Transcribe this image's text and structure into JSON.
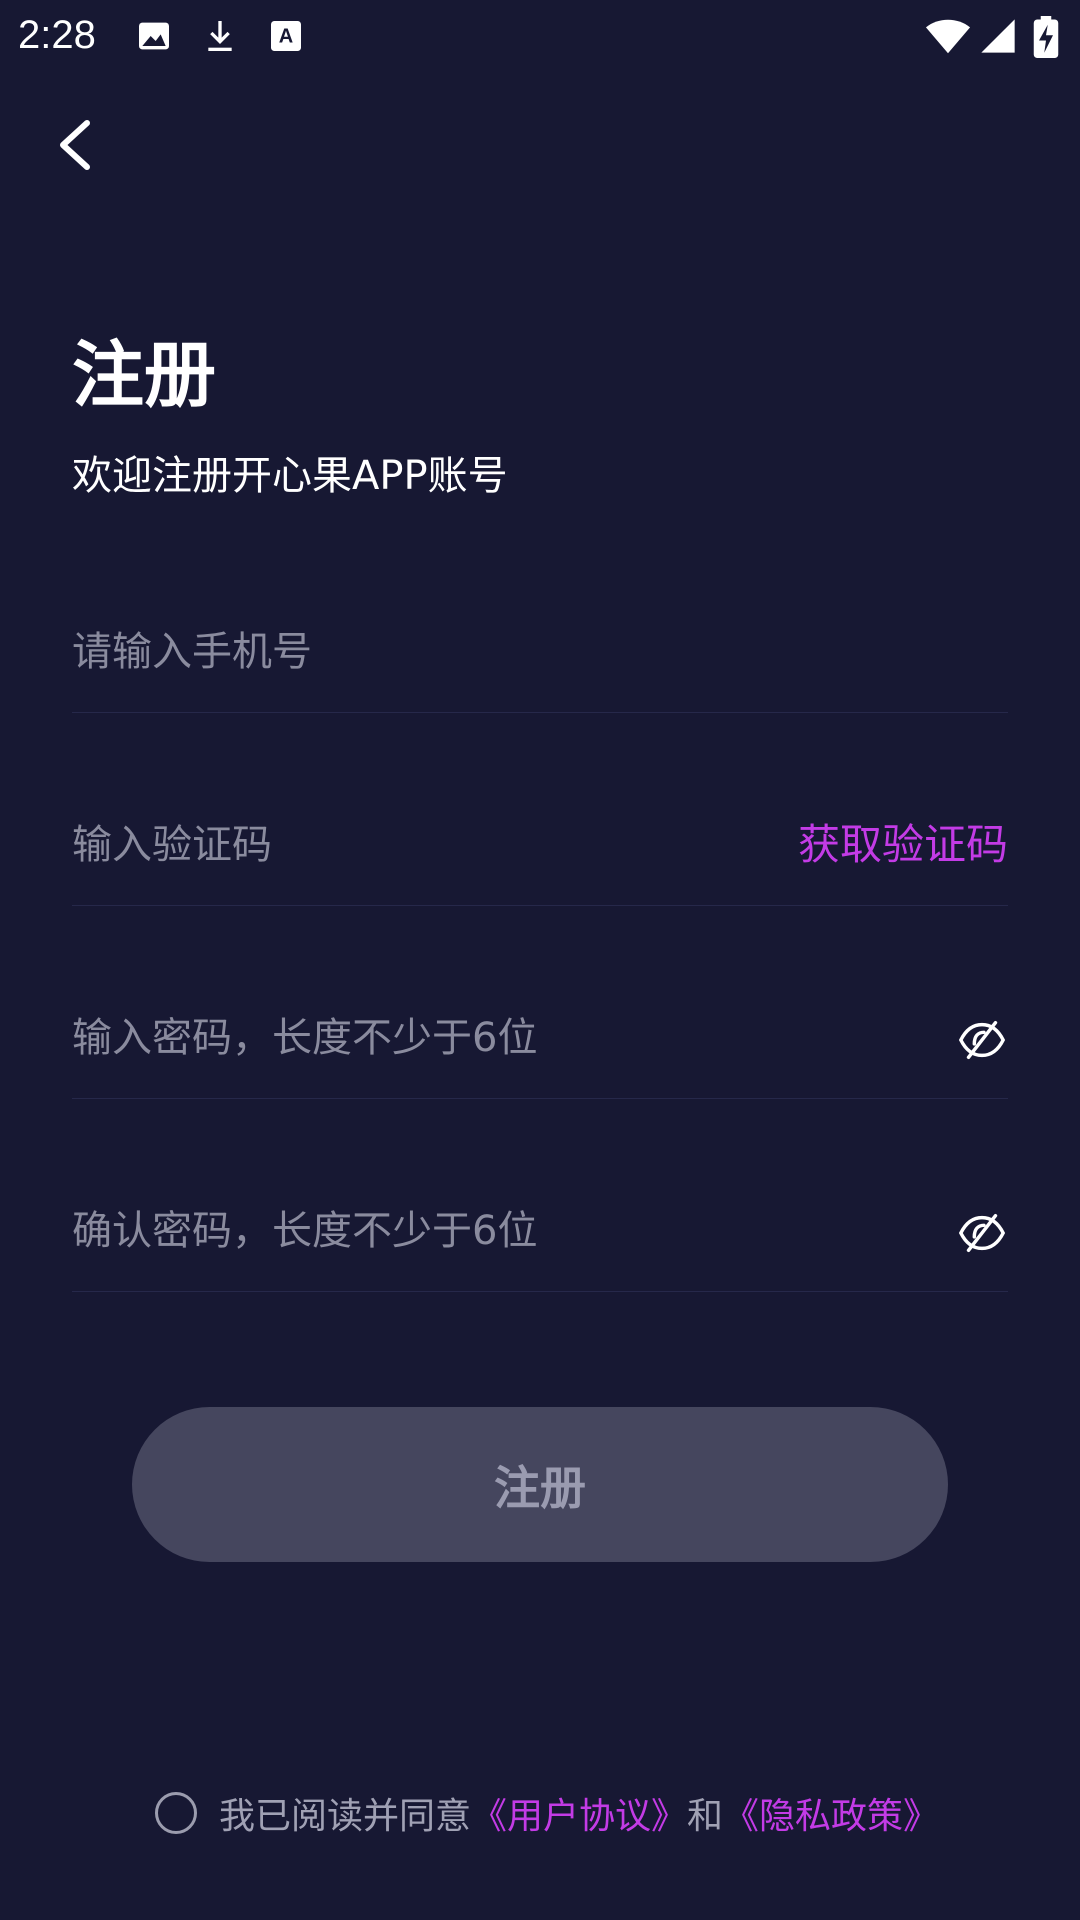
{
  "status_bar": {
    "time": "2:28",
    "left_icons": [
      "image-icon",
      "download-icon",
      "text-icon"
    ],
    "right_icons": [
      "wifi-icon",
      "cellular-signal-icon",
      "battery-charging-icon"
    ]
  },
  "header": {
    "back_icon": "chevron-left-icon"
  },
  "page": {
    "title": "注册",
    "subtitle": "欢迎注册开心果APP账号"
  },
  "form": {
    "phone_placeholder": "请输入手机号",
    "code_placeholder": "输入验证码",
    "get_code_label": "获取验证码",
    "password_placeholder": "输入密码，长度不少于6位",
    "confirm_placeholder": "确认密码，长度不少于6位",
    "visibility_icon": "eye-off-icon",
    "submit_label": "注册"
  },
  "agreement": {
    "prefix": "我已阅读并同意",
    "user_agreement": "《用户协议》",
    "conjunction": "和",
    "privacy_policy": "《隐私政策》",
    "checked": false
  },
  "colors": {
    "background": "#171833",
    "accent": "#c33be6",
    "button_disabled": "#45465e",
    "placeholder": "#8a8b9e"
  }
}
